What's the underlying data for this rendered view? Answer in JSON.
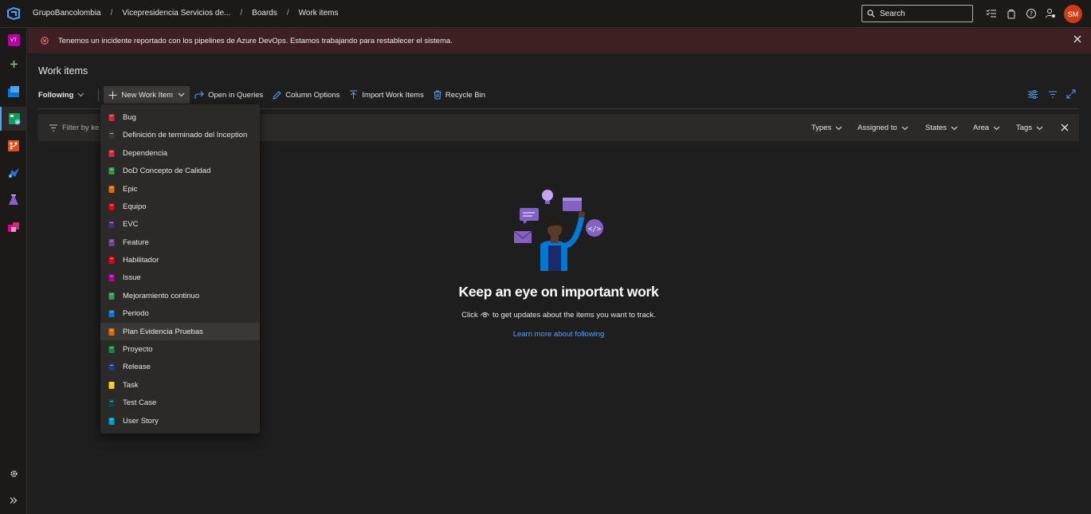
{
  "breadcrumbs": [
    "GrupoBancolombia",
    "Vicepresidencia Servicios de...",
    "Boards",
    "Work items"
  ],
  "search": {
    "placeholder": "Search"
  },
  "user": {
    "initials": "SM"
  },
  "project": {
    "initials": "VT"
  },
  "banner": {
    "message": "Tenemos un incidente reportado con los pipelines de Azure DevOps. Estamos trabajando para restablecer el sistema."
  },
  "page": {
    "title": "Work items"
  },
  "toolbar": {
    "following": "Following",
    "new_work_item": "New Work Item",
    "open_in_queries": "Open in Queries",
    "column_options": "Column Options",
    "import_work_items": "Import Work Items",
    "recycle_bin": "Recycle Bin"
  },
  "filter": {
    "keyword_placeholder": "Filter by ke",
    "chips": [
      "Types",
      "Assigned to",
      "States",
      "Area",
      "Tags"
    ]
  },
  "menu": {
    "items": [
      {
        "label": "Bug",
        "color": "#cc293d"
      },
      {
        "label": "Definición de terminado del Inception",
        "color": "#3a3a3a"
      },
      {
        "label": "Dependencia",
        "color": "#cc293d"
      },
      {
        "label": "DoD Concepto de Calidad",
        "color": "#339947"
      },
      {
        "label": "Epic",
        "color": "#e06c00"
      },
      {
        "label": "Equipo",
        "color": "#e60017"
      },
      {
        "label": "EVC",
        "color": "#4c2a7a"
      },
      {
        "label": "Feature",
        "color": "#773b93"
      },
      {
        "label": "Habilitador",
        "color": "#e60017"
      },
      {
        "label": "Issue",
        "color": "#b4009e"
      },
      {
        "label": "Mejoramiento continuo",
        "color": "#339947"
      },
      {
        "label": "Periodo",
        "color": "#0078d4"
      },
      {
        "label": "Plan Evidencia Pruebas",
        "color": "#e06c00"
      },
      {
        "label": "Proyecto",
        "color": "#10893e"
      },
      {
        "label": "Release",
        "color": "#1f3c8a"
      },
      {
        "label": "Task",
        "color": "#f2cb1d"
      },
      {
        "label": "Test Case",
        "color": "#004b50"
      },
      {
        "label": "User Story",
        "color": "#009ccc"
      }
    ]
  },
  "empty_state": {
    "title": "Keep an eye on important work",
    "subtitle_before": "Click",
    "subtitle_after": "to get updates about the items you want to track.",
    "link": "Learn more about following"
  }
}
